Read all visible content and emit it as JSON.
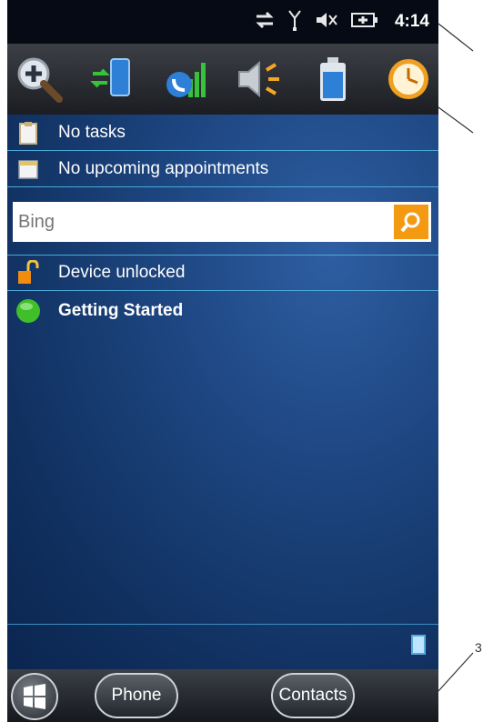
{
  "statusbar": {
    "time": "4:14",
    "icons": [
      "data-sync-icon",
      "signal-antenna-icon",
      "speaker-muted-icon",
      "battery-charging-icon"
    ]
  },
  "toolbar": {
    "icons": [
      "zoom-icon",
      "connectivity-icon",
      "phone-signal-icon",
      "volume-icon",
      "battery-icon",
      "clock-icon"
    ]
  },
  "today": {
    "tasks": "No tasks",
    "appointments": "No upcoming appointments",
    "search_placeholder": "Bing",
    "device_status": "Device unlocked",
    "getting_started": "Getting Started"
  },
  "taskbar": {
    "phone": "Phone",
    "contacts": "Contacts"
  },
  "callouts": {
    "bottom_number": "3"
  }
}
